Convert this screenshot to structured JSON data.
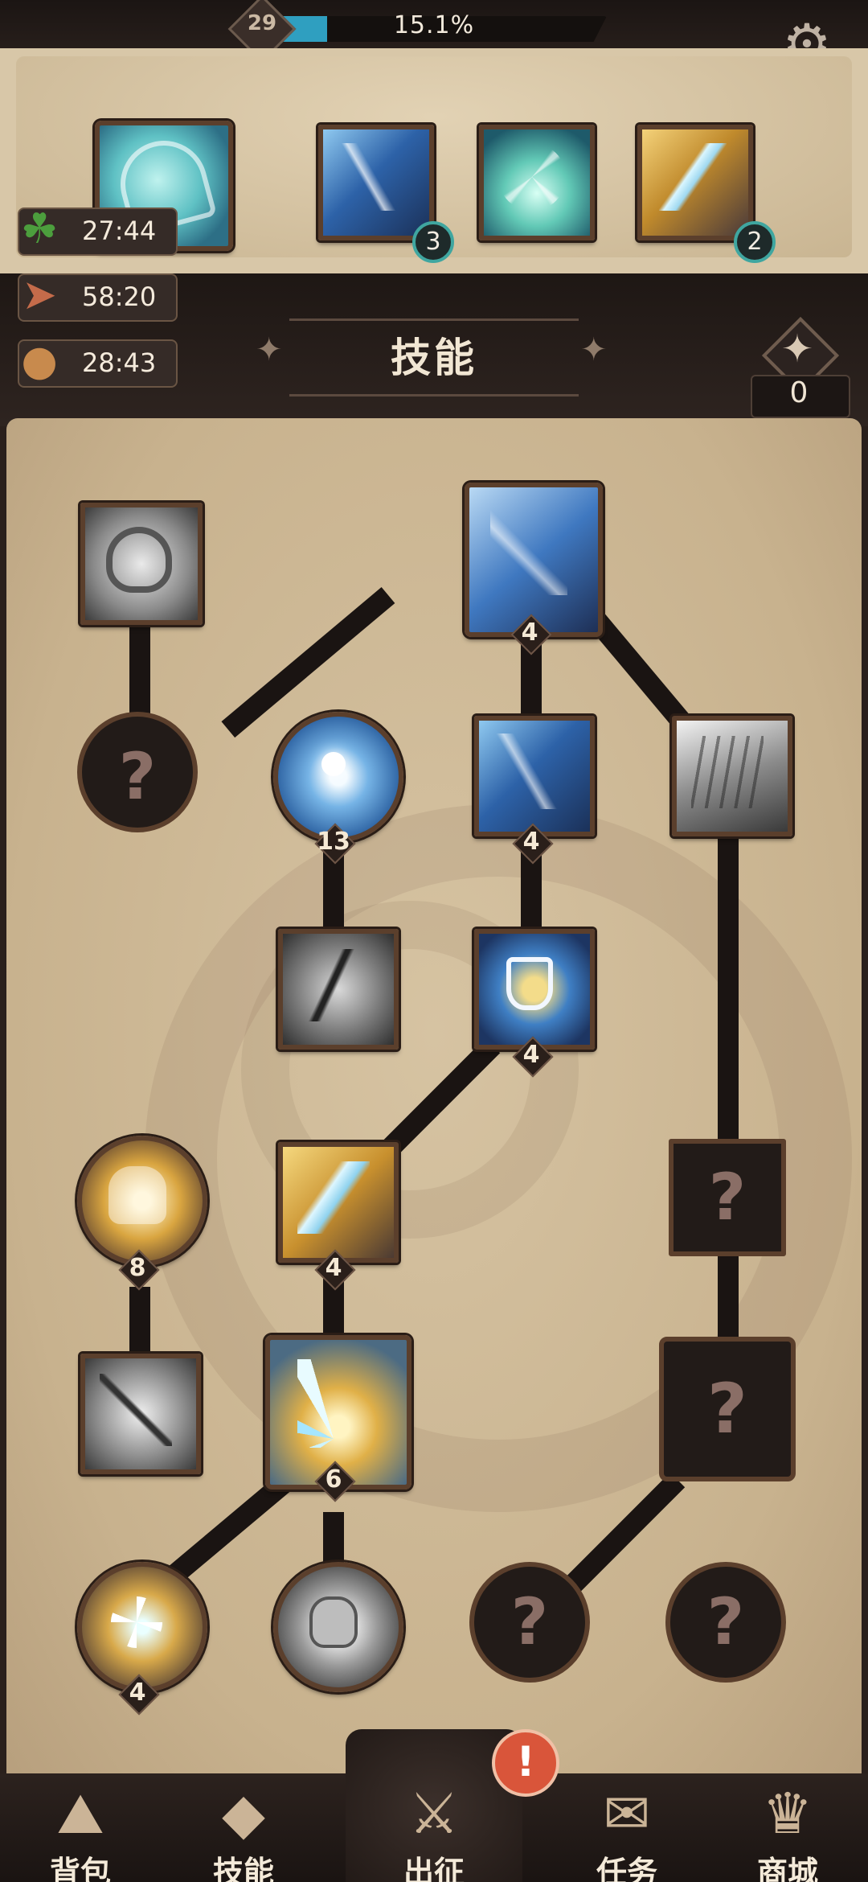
{
  "top_bar": {
    "level": "29",
    "xp_percent_text": "15.1%",
    "xp_fraction": 0.151,
    "settings_icon": "gear-icon"
  },
  "equipped": {
    "main_skill_icon": "ice-shield-icon",
    "slots": [
      {
        "icon": "blue-ice-slash-icon",
        "count": "3"
      },
      {
        "icon": "ice-crystal-burst-icon",
        "count": null
      },
      {
        "icon": "golden-lightning-spear-icon",
        "count": "2"
      }
    ]
  },
  "timers": [
    {
      "icon": "clover-icon",
      "value": "27:44"
    },
    {
      "icon": "speed-arrows-icon",
      "value": "58:20"
    },
    {
      "icon": "coin-bags-x2-icon",
      "value": "28:43"
    }
  ],
  "header": {
    "title": "技能",
    "skill_points_icon": "diamond-star-icon",
    "skill_points": "0"
  },
  "tree": {
    "nodes": [
      {
        "id": "holy-shield",
        "icon": "holy-shield-icon",
        "level": null,
        "locked": false
      },
      {
        "id": "ice-blade-root",
        "icon": "ice-blade-icon",
        "level": "4",
        "locked": false
      },
      {
        "id": "unknown-1",
        "icon": "question-icon",
        "level": null,
        "locked": true
      },
      {
        "id": "ice-orb",
        "icon": "ice-orb-hand-icon",
        "level": "13",
        "locked": false
      },
      {
        "id": "blue-slash",
        "icon": "blue-ice-slash-icon",
        "level": "4",
        "locked": false
      },
      {
        "id": "grey-shards",
        "icon": "ice-shards-icon",
        "level": null,
        "locked": false
      },
      {
        "id": "grey-crack",
        "icon": "crack-icon",
        "level": null,
        "locked": false
      },
      {
        "id": "ice-shield",
        "icon": "ice-shield-lightning-icon",
        "level": "4",
        "locked": false
      },
      {
        "id": "golden-hand",
        "icon": "golden-hand-icon",
        "level": "8",
        "locked": false
      },
      {
        "id": "golden-crystal",
        "icon": "golden-crystal-icon",
        "level": "4",
        "locked": false
      },
      {
        "id": "unknown-2",
        "icon": "question-icon",
        "level": null,
        "locked": true
      },
      {
        "id": "grey-arrow",
        "icon": "arrow-hand-icon",
        "level": null,
        "locked": false
      },
      {
        "id": "crystal-cluster",
        "icon": "crystal-cluster-icon",
        "level": "6",
        "locked": false
      },
      {
        "id": "unknown-3",
        "icon": "question-icon",
        "level": null,
        "locked": true
      },
      {
        "id": "star-burst",
        "icon": "star-burst-icon",
        "level": "4",
        "locked": false
      },
      {
        "id": "rock-burst",
        "icon": "rock-burst-icon",
        "level": null,
        "locked": false
      },
      {
        "id": "unknown-4",
        "icon": "question-icon",
        "level": null,
        "locked": true
      },
      {
        "id": "unknown-5",
        "icon": "question-icon",
        "level": null,
        "locked": true
      }
    ]
  },
  "nav": [
    {
      "label": "背包",
      "icon": "backpack-icon"
    },
    {
      "label": "技能",
      "icon": "skill-book-icon"
    },
    {
      "label": "出征",
      "icon": "sword-map-icon"
    },
    {
      "label": "任务",
      "icon": "scroll-quest-icon"
    },
    {
      "label": "商城",
      "icon": "crown-shop-icon"
    }
  ],
  "alert_symbol": "!",
  "locked_symbol": "?"
}
